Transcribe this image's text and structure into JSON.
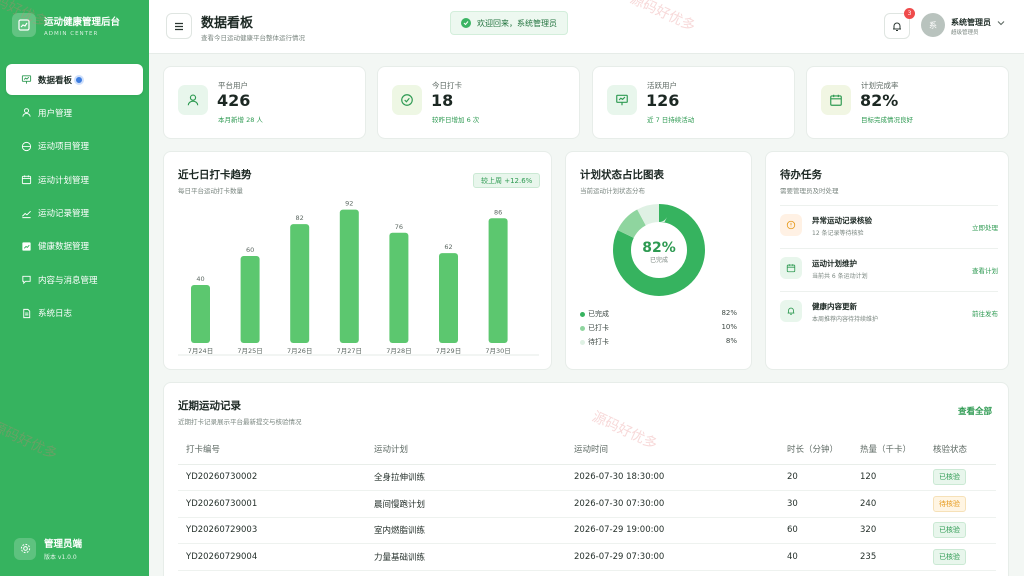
{
  "sidebar": {
    "brand_title": "运动健康管理后台",
    "brand_sub": "ADMIN CENTER",
    "items": [
      {
        "label": "数据看板",
        "icon": "presentation-chart-icon"
      },
      {
        "label": "用户管理",
        "icon": "user-icon"
      },
      {
        "label": "运动项目管理",
        "icon": "globe-icon"
      },
      {
        "label": "运动计划管理",
        "icon": "calendar-icon"
      },
      {
        "label": "运动记录管理",
        "icon": "trend-icon"
      },
      {
        "label": "健康数据管理",
        "icon": "chart-icon"
      },
      {
        "label": "内容与消息管理",
        "icon": "message-icon"
      },
      {
        "label": "系统日志",
        "icon": "document-icon"
      }
    ],
    "footer_title": "管理员端",
    "footer_version": "版本 v1.0.0"
  },
  "header": {
    "title": "数据看板",
    "subtitle": "查看今日运动健康平台整体运行情况",
    "welcome": "欢迎回来，系统管理员",
    "notification_count": "3",
    "avatar_char": "系",
    "user_name": "系统管理员",
    "user_role": "超级管理员"
  },
  "stats": [
    {
      "label": "平台用户",
      "value": "426",
      "note": "本月新增 28 人",
      "icon": "user-icon"
    },
    {
      "label": "今日打卡",
      "value": "18",
      "note": "较昨日增加 6 次",
      "icon": "check-circle-icon"
    },
    {
      "label": "活跃用户",
      "value": "126",
      "note": "近 7 日持续活动",
      "icon": "presentation-icon"
    },
    {
      "label": "计划完成率",
      "value": "82%",
      "note": "目标完成情况良好",
      "icon": "calendar-icon"
    }
  ],
  "trend": {
    "title": "近七日打卡趋势",
    "subtitle": "每日平台运动打卡数量",
    "pill": "较上周 +12.6%"
  },
  "chart_data": [
    {
      "type": "bar",
      "categories": [
        "7月24日",
        "7月25日",
        "7月26日",
        "7月27日",
        "7月28日",
        "7月29日",
        "7月30日"
      ],
      "values": [
        40,
        60,
        82,
        92,
        76,
        62,
        86
      ],
      "ylim": [
        0,
        100
      ],
      "color": "#5cc76f"
    },
    {
      "type": "pie",
      "categories": [
        "已完成",
        "已打卡",
        "待打卡"
      ],
      "values": [
        82,
        10,
        8
      ],
      "colors": [
        "#36b35f",
        "#8fd59f",
        "#dff1e4"
      ],
      "center_value": "82%",
      "center_label": "已完成"
    }
  ],
  "donut": {
    "title": "计划状态占比图表",
    "subtitle": "当前运动计划状态分布",
    "legend": [
      {
        "label": "已完成",
        "value": "82%",
        "color": "#36b35f"
      },
      {
        "label": "已打卡",
        "value": "10%",
        "color": "#8fd59f"
      },
      {
        "label": "待打卡",
        "value": "8%",
        "color": "#dff1e4"
      }
    ]
  },
  "tasks": {
    "title": "待办任务",
    "subtitle": "需要管理员及时处理",
    "items": [
      {
        "title": "异常运动记录核验",
        "desc": "12 条记录等待核验",
        "link": "立即处理",
        "icon": "alert-icon",
        "color": "#fff1e4",
        "iconColor": "#e69a1c"
      },
      {
        "title": "运动计划维护",
        "desc": "当前共 6 条运动计划",
        "link": "查看计划",
        "icon": "calendar-icon",
        "color": "#e8f6ec",
        "iconColor": "#2e9a52"
      },
      {
        "title": "健康内容更新",
        "desc": "本周推荐内容待持续维护",
        "link": "前往发布",
        "icon": "bell-icon",
        "color": "#e8f6ec",
        "iconColor": "#2e9a52"
      }
    ]
  },
  "records": {
    "title": "近期运动记录",
    "subtitle": "近期打卡记录展示平台最新提交与核验情况",
    "view_all": "查看全部",
    "columns": [
      "打卡编号",
      "运动计划",
      "运动时间",
      "时长（分钟）",
      "热量（千卡）",
      "核验状态"
    ],
    "rows": [
      [
        "YD20260730002",
        "全身拉伸训练",
        "2026-07-30 18:30:00",
        "20",
        "120",
        "已核验"
      ],
      [
        "YD20260730001",
        "晨间慢跑计划",
        "2026-07-30 07:30:00",
        "30",
        "240",
        "待核验"
      ],
      [
        "YD20260729003",
        "室内燃脂训练",
        "2026-07-29 19:00:00",
        "60",
        "320",
        "已核验"
      ],
      [
        "YD20260729004",
        "力量基础训练",
        "2026-07-29 07:30:00",
        "40",
        "235",
        "已核验"
      ]
    ]
  },
  "watermark": "源码好优多"
}
